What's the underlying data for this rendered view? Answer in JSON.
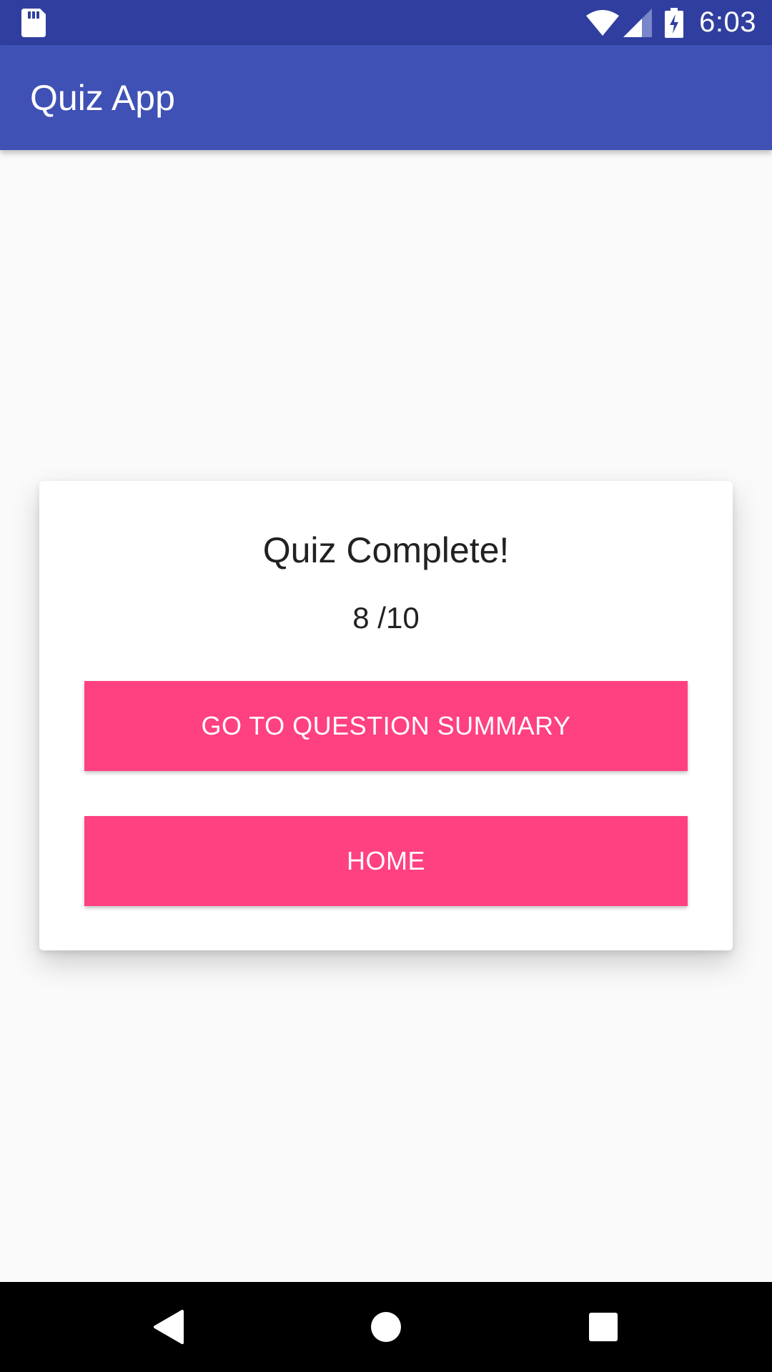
{
  "status_bar": {
    "time": "6:03",
    "icons": [
      "sd-card-icon",
      "wifi-icon",
      "cell-signal-icon",
      "battery-charging-icon"
    ]
  },
  "app_bar": {
    "title": "Quiz App"
  },
  "result_card": {
    "title": "Quiz Complete!",
    "score": "8 /10",
    "summary_button_label": "GO TO QUESTION SUMMARY",
    "home_button_label": "HOME"
  },
  "nav_bar": {
    "icons": [
      "back-icon",
      "home-icon",
      "recents-icon"
    ]
  },
  "colors": {
    "status_bar": "#303F9F",
    "app_bar": "#3F51B5",
    "accent": "#FF4081",
    "background": "#FAFAFA",
    "card": "#FFFFFF",
    "text_primary": "#212121"
  }
}
